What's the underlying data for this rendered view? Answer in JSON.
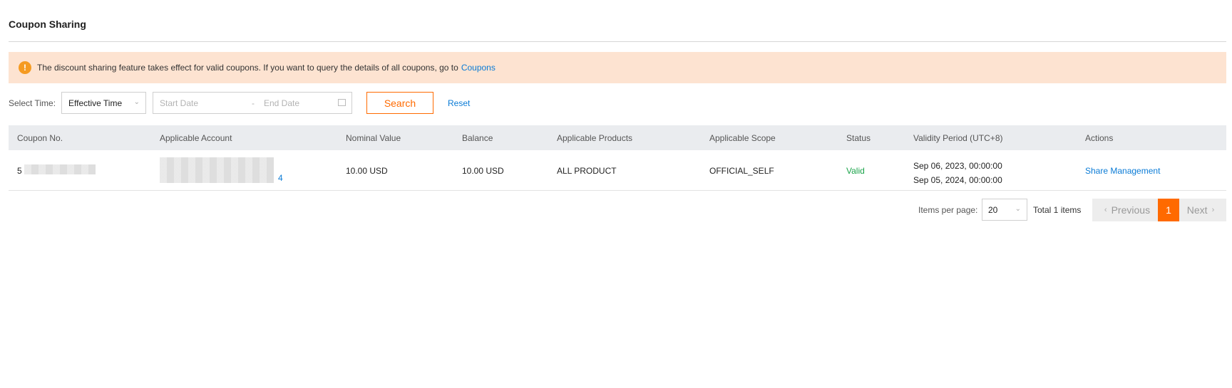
{
  "page": {
    "title": "Coupon Sharing"
  },
  "notice": {
    "text": "The discount sharing feature takes effect for valid coupons. If you want to query the details of all coupons, go to",
    "link": "Coupons",
    "icon": "info-icon",
    "background": "#fde3d1"
  },
  "filter": {
    "label": "Select Time:",
    "type_value": "Effective Time",
    "start_placeholder": "Start Date",
    "separator": "-",
    "end_placeholder": "End Date",
    "search_label": "Search",
    "reset_label": "Reset"
  },
  "table": {
    "columns": [
      "Coupon No.",
      "Applicable Account",
      "Nominal Value",
      "Balance",
      "Applicable Products",
      "Applicable Scope",
      "Status",
      "Validity Period (UTC+8)",
      "Actions"
    ],
    "rows": [
      {
        "coupon_no": "5",
        "account_suffix": "4",
        "nominal_value": "10.00 USD",
        "balance": "10.00 USD",
        "products": "ALL PRODUCT",
        "scope": "OFFICIAL_SELF",
        "status": "Valid",
        "validity_start": "Sep 06, 2023, 00:00:00",
        "validity_end": "Sep 05, 2024, 00:00:00",
        "action": "Share Management"
      }
    ]
  },
  "pagination": {
    "items_per_page_label": "Items per page:",
    "items_per_page": "20",
    "total": "Total 1 items",
    "prev": "Previous",
    "page": "1",
    "next": "Next"
  },
  "colors": {
    "accent": "#ff6a00",
    "link": "#0a7bd6",
    "valid": "#1aa34a"
  }
}
